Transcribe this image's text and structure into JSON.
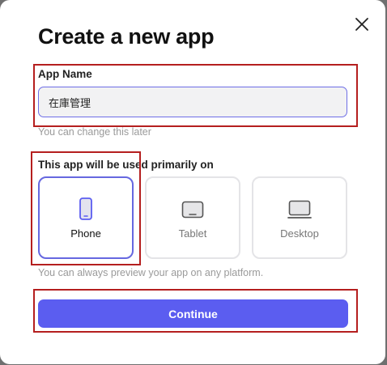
{
  "dialog": {
    "title": "Create a new app",
    "app_name": {
      "label": "App Name",
      "value": "在庫管理",
      "hint": "You can change this later"
    },
    "platform": {
      "label": "This app will be used primarily on",
      "options": [
        {
          "label": "Phone",
          "icon": "phone-icon",
          "selected": true
        },
        {
          "label": "Tablet",
          "icon": "tablet-icon",
          "selected": false
        },
        {
          "label": "Desktop",
          "icon": "desktop-icon",
          "selected": false
        }
      ],
      "hint": "You can always preview your app on any platform."
    },
    "continue_label": "Continue"
  },
  "colors": {
    "accent": "#5b5df0",
    "selected_border": "#6668e0",
    "highlight_box": "#b51f1f"
  }
}
